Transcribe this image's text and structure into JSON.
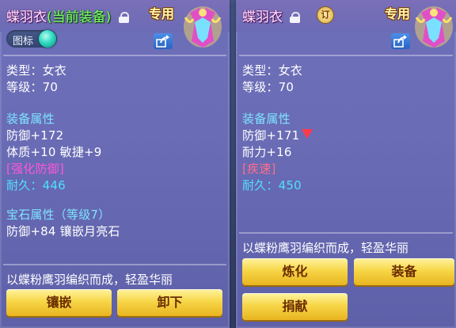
{
  "left": {
    "title": "蝶羽衣",
    "equipped": "(当前装备)",
    "exclusive": "专用",
    "icon_toggle": "图标",
    "type": "类型：女衣",
    "level": "等级：70",
    "section_attr": "装备属性",
    "defense": "防御+172",
    "stats": "体质+10 敏捷+9",
    "special": "[强化防御]",
    "durability": "耐久：446",
    "gem_header": "宝石属性（等级7）",
    "gem_line": "防御+84 镶嵌月亮石",
    "description": "以蝶粉鹰羽编织而成，轻盈华丽",
    "buttons": [
      "镶嵌",
      "卸下"
    ]
  },
  "right": {
    "title": "蝶羽衣",
    "exclusive": "专用",
    "badge": "订",
    "type": "类型：女衣",
    "level": "等级：70",
    "section_attr": "装备属性",
    "defense": "防御+171",
    "endurance": "耐力+16",
    "special": "[疾速]",
    "durability": "耐久：450",
    "description": "以蝶粉鹰羽编织而成，轻盈华丽",
    "buttons": [
      "炼化",
      "装备",
      "捐献"
    ]
  },
  "colors": {
    "accent_green": "#7dff6a",
    "section_blue": "#7ee3ff",
    "special_magenta": "#ff57d7",
    "button_gold": "#f7d648"
  },
  "icons": [
    "lock-icon",
    "share-icon",
    "item-icon",
    "arrow-down-icon",
    "bound-badge-icon"
  ]
}
